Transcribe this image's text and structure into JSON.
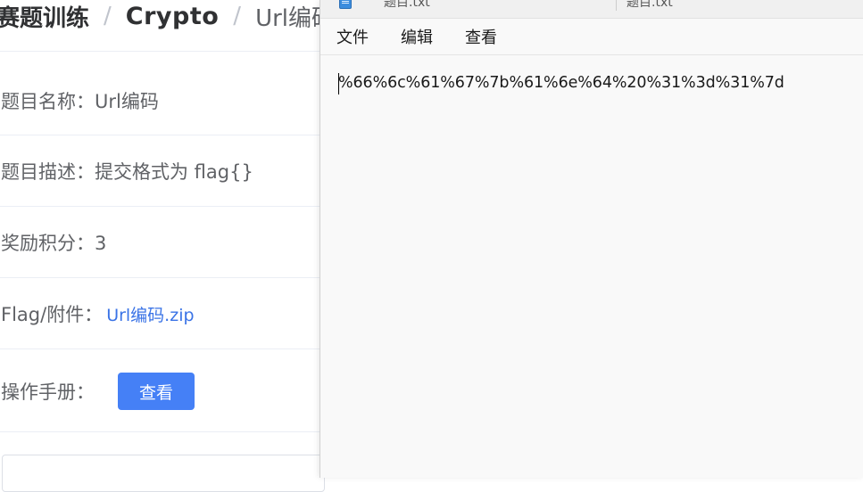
{
  "web": {
    "breadcrumb": {
      "root": "赛题训练",
      "sep1": "/",
      "category": "Crypto",
      "sep2": "/",
      "current": "Url编码"
    },
    "rows": {
      "name": "题目名称：Url编码",
      "description": "题目描述：提交格式为 flag{}",
      "points": "奖励积分：3",
      "flag_label": "Flag/附件：",
      "attachment": "Url编码.zip",
      "manual_label": "操作手册：",
      "view_button": "查看"
    }
  },
  "notepad": {
    "tabs": [
      {
        "title": "题目.txt",
        "icon": "notepad-file-icon"
      },
      {
        "title": "题目.txt"
      }
    ],
    "menu": [
      "文件",
      "编辑",
      "查看"
    ],
    "content": "%66%6c%61%67%7b%61%6e%64%20%31%3d%31%7d"
  },
  "colors": {
    "link": "#3a73e6",
    "primary_button": "#4580f6",
    "notepad_bg": "#f9f9f9"
  }
}
